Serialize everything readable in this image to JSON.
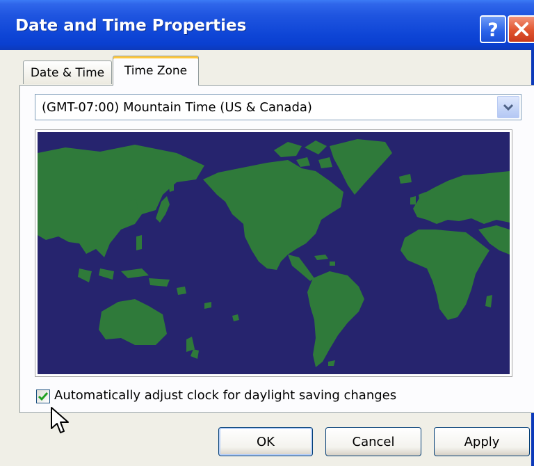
{
  "window": {
    "title": "Date and Time Properties",
    "help_glyph": "?",
    "title_bar_color": "#0a3fd0",
    "close_color": "#e0542e"
  },
  "tabs": [
    {
      "label": "Date & Time",
      "active": false
    },
    {
      "label": "Time Zone",
      "active": true
    }
  ],
  "timezone": {
    "selected": "(GMT-07:00) Mountain Time (US & Canada)"
  },
  "map": {
    "ocean_color": "#26246e",
    "land_color": "#2f7a3a"
  },
  "daylight_saving": {
    "label": "Automatically adjust clock for daylight saving changes",
    "checked": true,
    "check_color": "#21a121"
  },
  "buttons": {
    "ok": "OK",
    "cancel": "Cancel",
    "apply": "Apply"
  },
  "icons": [
    "help-icon",
    "close-icon",
    "dropdown-arrow-icon",
    "checkmark-icon",
    "mouse-pointer-icon"
  ]
}
